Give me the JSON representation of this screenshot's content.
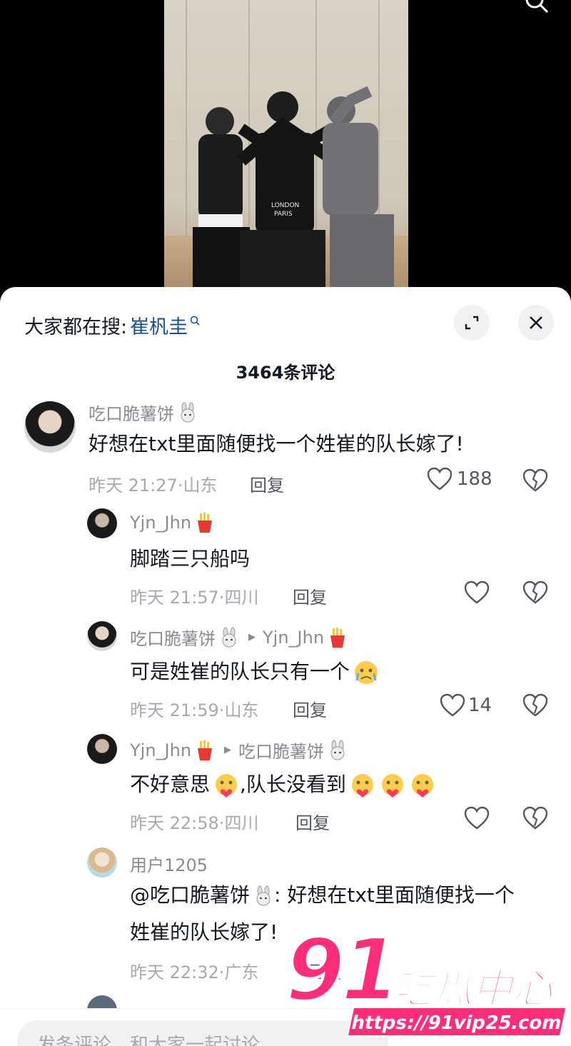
{
  "colors": {
    "accent_keyword": "#1d4f91",
    "text_primary": "#161823",
    "text_secondary": "#8a8b91",
    "watermark": "#ff2d7a"
  },
  "search_suggest": {
    "prefix": "大家都在搜:",
    "keyword": "崔杋圭",
    "icon": "search-icon"
  },
  "comment_count": "3464条评论",
  "comments": [
    {
      "user": "吃口脆薯饼",
      "user_emoji": "rabbit-emoji",
      "text": "好想在txt里面随便找一个姓崔的队长嫁了!",
      "time": "昨天 21:27",
      "location": "山东",
      "reply_label": "回复",
      "likes": "188"
    },
    {
      "user": "Yjn_Jhn",
      "user_emoji": "fries-emoji",
      "text": "脚踏三只船吗",
      "time": "昨天 21:57",
      "location": "四川",
      "reply_label": "回复",
      "likes": ""
    },
    {
      "user": "吃口脆薯饼",
      "user_emoji": "rabbit-emoji",
      "reply_to": "Yjn_Jhn",
      "reply_to_emoji": "fries-emoji",
      "text": "可是姓崔的队长只有一个",
      "time": "昨天 21:59",
      "location": "山东",
      "reply_label": "回复",
      "likes": "14"
    },
    {
      "user": "Yjn_Jhn",
      "user_emoji": "fries-emoji",
      "reply_to": "吃口脆薯饼",
      "reply_to_emoji": "rabbit-emoji",
      "text_a": "不好意思",
      "text_b": ",队长没看到",
      "time": "昨天 22:58",
      "location": "四川",
      "reply_label": "回复",
      "likes": ""
    },
    {
      "user": "用户1205",
      "text_line1_a": "@吃口脆薯饼",
      "text_line1_b": ": 好想在txt里面随便找一个",
      "text_line2": "姓崔的队长嫁了!",
      "time": "昨天 22:32",
      "location": "广东",
      "reply_label": "回复"
    }
  ],
  "input_placeholder": "发条评论，和大家一起讨论",
  "watermark": {
    "number": "91",
    "title": "吃瓜中心",
    "url": "https://91vip25.com"
  }
}
